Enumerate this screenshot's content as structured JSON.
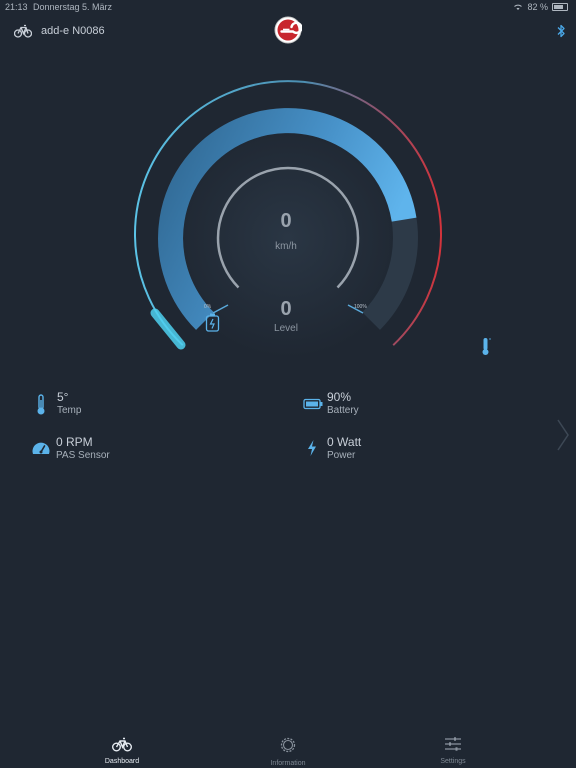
{
  "status_bar": {
    "time": "21:13",
    "date": "Donnerstag 5. März",
    "battery": "82 %"
  },
  "header": {
    "device_name": "add-e N0086"
  },
  "gauge": {
    "speed": "0",
    "speed_unit": "km/h",
    "level": "0",
    "level_label": "Level",
    "min_label": "0%",
    "max_label": "100%",
    "assist_fill_fraction": 0.8
  },
  "metrics": {
    "temp": {
      "value": "5°",
      "label": "Temp"
    },
    "battery": {
      "value": "90%",
      "label": "Battery"
    },
    "pas": {
      "value": "0 RPM",
      "label": "PAS Sensor"
    },
    "power": {
      "value": "0 Watt",
      "label": "Power"
    }
  },
  "tabbar": {
    "tabs": [
      {
        "label": "Dashboard"
      },
      {
        "label": "Information"
      },
      {
        "label": "Settings"
      }
    ]
  },
  "colors": {
    "background": "#1f2732",
    "accent": "#5bb3ea",
    "arc_red": "#d2333b"
  }
}
